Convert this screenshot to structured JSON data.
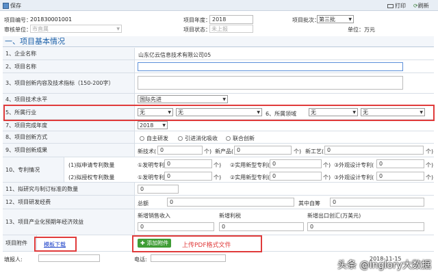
{
  "toolbar": {
    "save_label": "保存",
    "print_label": "打印",
    "refresh_label": "刷新"
  },
  "header": {
    "project_no_label": "项目编号：",
    "project_no": "201830001001",
    "year_label": "项目年度：",
    "year": "2018",
    "batch_label": "项目批次：",
    "batch": "第三批",
    "audit_unit_label": "审核单位：",
    "audit_unit": "市直属",
    "status_label": "项目状态：",
    "status": "未上报",
    "unit_label": "单位：万元"
  },
  "section_title": "一、项目基本情况",
  "rows": {
    "company_label": "1、企业名称",
    "company_value": "山东亿云信息技术有限公司05",
    "project_name_label": "2、项目名称",
    "innovation_label": "3、项目创新内容及技术指标（150-200字）",
    "tech_level_label": "4、项目技术水平",
    "tech_level_value": "国际先进",
    "industry_label": "5、所属行业",
    "industry_sel1": "无",
    "industry_sel2": "无",
    "field_label": "6、所属领域",
    "field_sel1": "无",
    "field_sel2": "无",
    "finish_year_label": "7、项目完成年度",
    "finish_year_value": "2018",
    "method_label": "8、项目创新方式",
    "method_opt1": "自主研发",
    "method_opt2": "引进消化吸收",
    "method_opt3": "联合创新",
    "result_label": "9、项目创新成果",
    "result_tech": "新技术(",
    "result_product": "新产品(",
    "result_process": "新工艺(",
    "unit_ge": "个)",
    "patent_label": "10、专利情况",
    "patent_apply_label": "(1)拟申请专利数量",
    "patent_auth_label": "(2)拟授权专利数量",
    "invent_patent": "①发明专利(",
    "utility_patent": "②实用新型专利(",
    "design_patent": "③外观设计专利(",
    "standard_label": "11、拟研究与制订标准的数量",
    "rd_label": "12、项目研发经费",
    "rd_total_label": "总额",
    "rd_self_label": "其中自筹",
    "benefit_label": "13、项目产业化预期年经济效益",
    "benefit_sales": "新增销售收入",
    "benefit_tax": "新增利税",
    "benefit_export": "新增出口创汇(万美元)",
    "zero": "0",
    "attach_label": "项目附件",
    "template_link": "模板下载",
    "add_attach_btn": "添加附件",
    "upload_hint": "上传PDF格式文件"
  },
  "footer": {
    "filler_label": "填报人:",
    "phone_label": "电话:",
    "date": "2018-11-15"
  },
  "watermark": "头条 @Inglory大数据"
}
